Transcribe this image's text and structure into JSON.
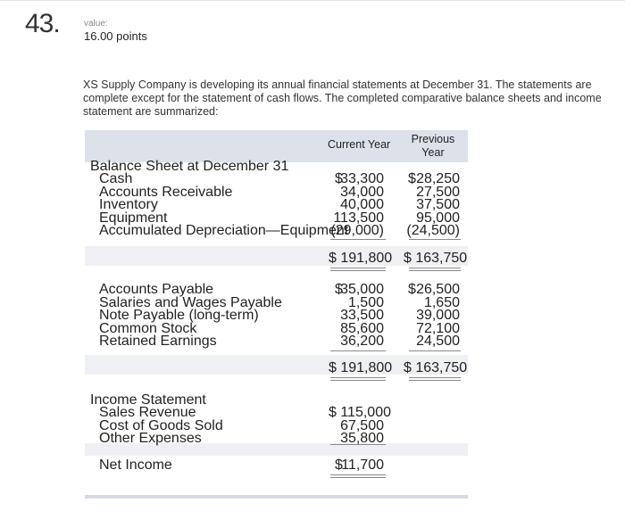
{
  "question": {
    "number": "43.",
    "value_label": "value:",
    "value_points": "16.00 points"
  },
  "intro": "XS Supply Company is developing its annual financial statements at December 31. The statements are complete except for the statement of cash flows. The completed comparative balance sheets and income statement are summarized:",
  "columns": {
    "current": "Current Year",
    "previous": "Previous Year"
  },
  "balance_sheet": {
    "heading": "Balance Sheet at December 31",
    "assets": [
      {
        "label": "Cash",
        "current": "33,300",
        "previous": "28,250",
        "dollar": true
      },
      {
        "label": "Accounts Receivable",
        "current": "34,000",
        "previous": "27,500"
      },
      {
        "label": "Inventory",
        "current": "40,000",
        "previous": "37,500"
      },
      {
        "label": "Equipment",
        "current": "113,500",
        "previous": "95,000"
      },
      {
        "label": "Accumulated Depreciation—Equipment",
        "current": "(29,000)",
        "previous": "(24,500)"
      }
    ],
    "assets_total": {
      "current": "$ 191,800",
      "previous": "$ 163,750"
    },
    "liabilities": [
      {
        "label": "Accounts Payable",
        "current": "35,000",
        "previous": "26,500",
        "dollar": true
      },
      {
        "label": "Salaries and Wages Payable",
        "current": "1,500",
        "previous": "1,650"
      },
      {
        "label": "Note Payable (long-term)",
        "current": "33,500",
        "previous": "39,000"
      },
      {
        "label": "Common Stock",
        "current": "85,600",
        "previous": "72,100"
      },
      {
        "label": "Retained Earnings",
        "current": "36,200",
        "previous": "24,500"
      }
    ],
    "liabilities_total": {
      "current": "$ 191,800",
      "previous": "$ 163,750"
    }
  },
  "income_statement": {
    "heading": "Income Statement",
    "rows": [
      {
        "label": "Sales Revenue",
        "current": "$ 115,000"
      },
      {
        "label": "Cost of Goods Sold",
        "current": "67,500"
      },
      {
        "label": "Other Expenses",
        "current": "35,800"
      }
    ],
    "net_income": {
      "label": "Net Income",
      "current": "11,700"
    }
  },
  "currency_symbol": "$"
}
